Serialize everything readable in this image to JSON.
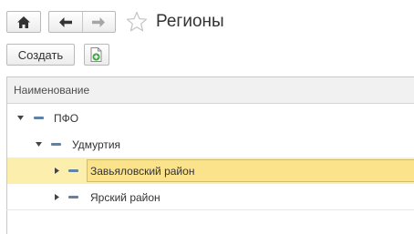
{
  "toolbar": {
    "home_icon": "home-icon",
    "back_icon": "arrow-left-icon",
    "forward_icon": "arrow-right-icon",
    "favorite_icon": "star-outline-icon",
    "title": "Регионы"
  },
  "actions": {
    "create_label": "Создать",
    "add_icon": "document-add-icon"
  },
  "tree": {
    "column_header": "Наименование",
    "rows": [
      {
        "label": "ПФО",
        "level": 0,
        "expanded": true,
        "selected": false
      },
      {
        "label": "Удмуртия",
        "level": 1,
        "expanded": true,
        "selected": false
      },
      {
        "label": "Завьяловский район",
        "level": 2,
        "expanded": false,
        "selected": true
      },
      {
        "label": "Ярский район",
        "level": 2,
        "expanded": false,
        "selected": false
      }
    ]
  },
  "colors": {
    "selected_row": "#fcefae",
    "selected_cell": "#fbe38b",
    "group_marker": "#5f82a8",
    "add_icon_green": "#3fa33f"
  }
}
